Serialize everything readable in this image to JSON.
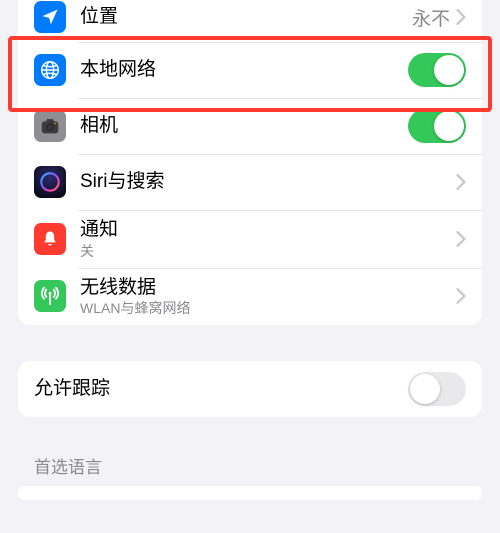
{
  "group1": {
    "location": {
      "label": "位置",
      "value": "永不"
    },
    "localNetwork": {
      "label": "本地网络",
      "on": true
    },
    "camera": {
      "label": "相机",
      "on": true
    },
    "siri": {
      "label": "Siri与搜索"
    },
    "notifications": {
      "label": "通知",
      "sub": "关"
    },
    "wireless": {
      "label": "无线数据",
      "sub": "WLAN与蜂窝网络"
    }
  },
  "group2": {
    "tracking": {
      "label": "允许跟踪",
      "on": false
    }
  },
  "sectionHeader": "首选语言",
  "colors": {
    "blue": "#007aff",
    "gray": "#8e8e93",
    "red": "#ff3b30",
    "green": "#34c759",
    "siriTop": "#2b2ba8",
    "siriBottom": "#ff2d8d"
  }
}
